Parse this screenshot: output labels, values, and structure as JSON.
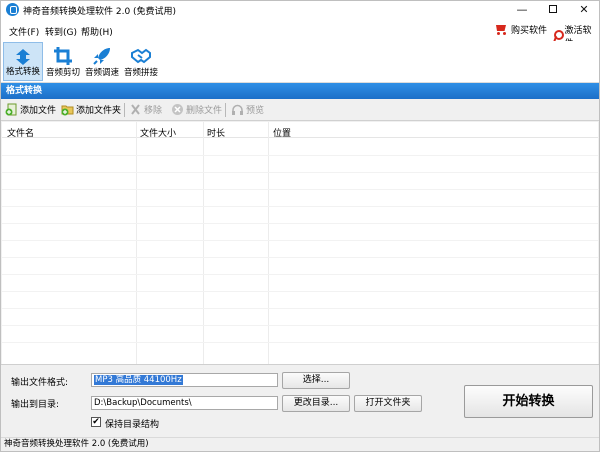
{
  "window": {
    "title": "神奇音频转换处理软件 2.0 (免费试用)",
    "controls": {
      "minimize": "—",
      "close": "✕"
    }
  },
  "menu": {
    "items": [
      "文件(F)",
      "转到(G)",
      "帮助(H)"
    ],
    "buy_label": "购买软件",
    "activate_label": "激活软件"
  },
  "toolbar": {
    "tools": [
      {
        "label": "格式转换",
        "icon": "format-convert-icon",
        "active": true
      },
      {
        "label": "音频剪切",
        "icon": "crop-icon",
        "active": false
      },
      {
        "label": "音频调速",
        "icon": "rocket-icon",
        "active": false
      },
      {
        "label": "音频拼接",
        "icon": "handshake-icon",
        "active": false
      }
    ]
  },
  "section": {
    "title": "格式转换"
  },
  "actions": {
    "add_file": "添加文件",
    "add_folder": "添加文件夹",
    "remove": "移除",
    "delete_file": "删除文件",
    "preview": "预览"
  },
  "table": {
    "columns": [
      "文件名",
      "文件大小",
      "时长",
      "位置"
    ],
    "rows": []
  },
  "output": {
    "format_label": "输出文件格式:",
    "format_value": "MP3 高品质 44100Hz",
    "choose_button": "选择...",
    "dir_label": "输出到目录:",
    "dir_value": "D:\\Backup\\Documents\\",
    "change_dir_button": "更改目录...",
    "open_folder_button": "打开文件夹",
    "keep_structure_label": "保持目录结构",
    "keep_structure_checked": true,
    "start_button": "开始转换"
  },
  "status": {
    "text": "神奇音频转换处理软件 2.0 (免费试用)"
  },
  "colors": {
    "accent": "#1c6fc8",
    "active_tool_bg": "#cde4f7",
    "brand_red": "#d7281c",
    "selection": "#3379d6"
  }
}
